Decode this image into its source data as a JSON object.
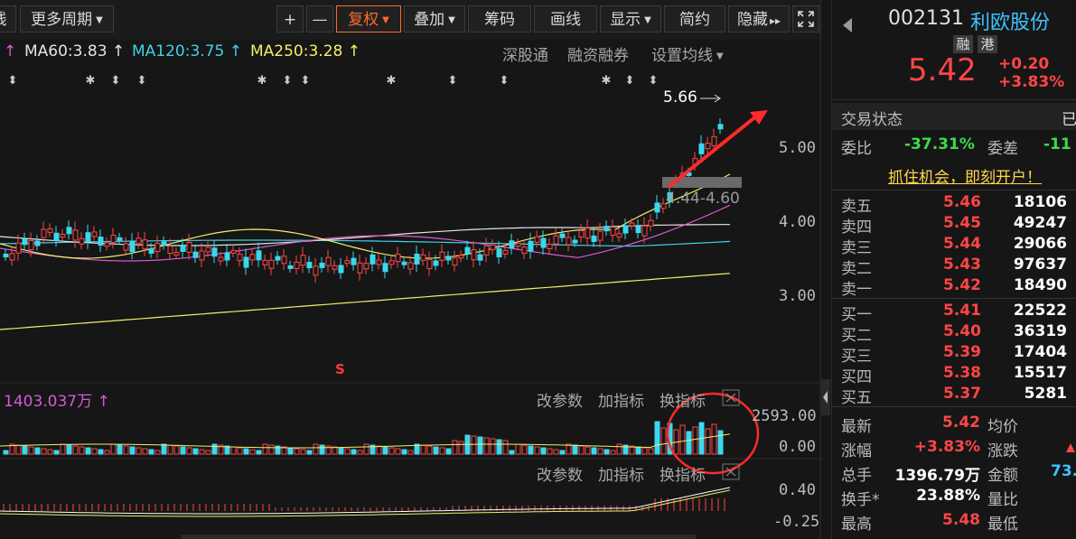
{
  "toolbar": {
    "left_partial": "线",
    "more_period": "更多周期",
    "plus": "+",
    "minus": "—",
    "fuquan": "复权",
    "overlay": "叠加",
    "chips": "筹码",
    "draw": "画线",
    "display": "显示",
    "simple": "简约",
    "hide": "隐藏",
    "hide_arrows": "▸▸",
    "expand_icon": "expand-icon"
  },
  "ma_legend": {
    "partial_arrow": "↑",
    "ma60": "MA60:3.83 ↑",
    "ma120": "MA120:3.75 ↑",
    "ma250": "MA250:3.28 ↑",
    "colors": {
      "ma60": "#e6e6e6",
      "ma120": "#3fd3e8",
      "ma250": "#f4ee6a",
      "partial": "#d45ad4"
    }
  },
  "chart_links": {
    "shenguтong": "深股通",
    "margin": "融资融券",
    "set_ma": "设置均线"
  },
  "main_chart": {
    "high_label": "5.66",
    "gap_label": "4.44-4.60",
    "s_marker": "S",
    "y_ticks": [
      "5.00",
      "4.00",
      "3.00"
    ]
  },
  "volume_pane": {
    "value_label": "1403.037万 ↑",
    "modify_params": "改参数",
    "add_indicator": "加指标",
    "switch_indicator": "换指标",
    "y_top": "2593.00",
    "y_bottom": "0.00"
  },
  "macd_pane": {
    "modify_params": "改参数",
    "add_indicator": "加指标",
    "switch_indicator": "换指标",
    "y_top": "0.40",
    "y_bottom": "-0.25"
  },
  "quote": {
    "code": "002131",
    "name": "利欧股份",
    "tags": [
      "融",
      "港"
    ],
    "price": "5.42",
    "change": "+0.20",
    "change_pct": "+3.83%",
    "trade_status_label": "交易状态",
    "trade_status_value": "已",
    "wei_bi_label": "委比",
    "wei_bi_value": "-37.31%",
    "wei_cha_label": "委差",
    "wei_cha_value": "-11",
    "promo": "抓住机会，即刻开户！"
  },
  "order_book": {
    "sells": [
      {
        "label": "卖五",
        "price": "5.46",
        "volume": "18106"
      },
      {
        "label": "卖四",
        "price": "5.45",
        "volume": "49247"
      },
      {
        "label": "卖三",
        "price": "5.44",
        "volume": "29066"
      },
      {
        "label": "卖二",
        "price": "5.43",
        "volume": "97637"
      },
      {
        "label": "卖一",
        "price": "5.42",
        "volume": "18490"
      }
    ],
    "buys": [
      {
        "label": "买一",
        "price": "5.41",
        "volume": "22522"
      },
      {
        "label": "买二",
        "price": "5.40",
        "volume": "36319"
      },
      {
        "label": "买三",
        "price": "5.39",
        "volume": "17404"
      },
      {
        "label": "买四",
        "price": "5.38",
        "volume": "15517"
      },
      {
        "label": "买五",
        "price": "5.37",
        "volume": "5281"
      }
    ]
  },
  "stats": {
    "latest_label": "最新",
    "latest_value": "5.42",
    "avg_label": "均价",
    "chg_pct_label": "涨幅",
    "chg_pct_value": "+3.83%",
    "chg_label": "涨跌",
    "total_hand_label": "总手",
    "total_hand_value": "1396.79万",
    "amount_label": "金额",
    "amount_value": "73.",
    "turnover_label": "换手*",
    "turnover_value": "23.88%",
    "vol_ratio_label": "量比",
    "high_label": "最高",
    "high_value": "5.48",
    "low_label": "最低"
  }
}
